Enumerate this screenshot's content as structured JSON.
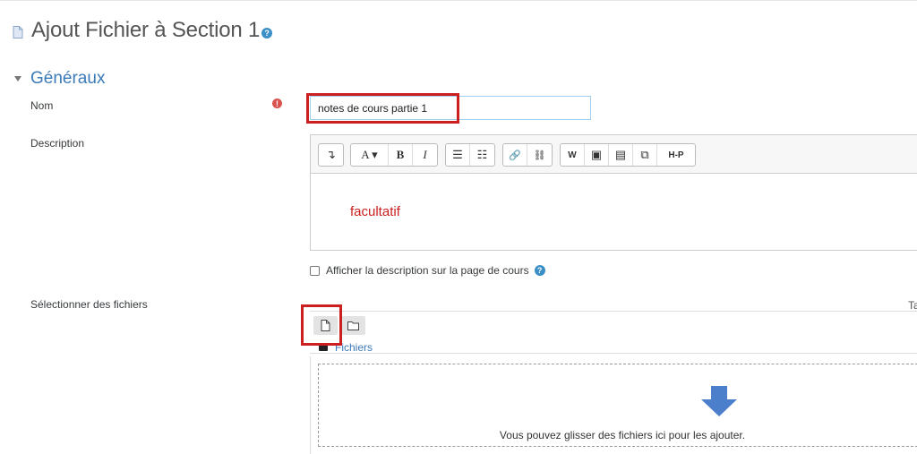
{
  "page": {
    "title": "Ajout Fichier à Section 1",
    "help_glyph": "?"
  },
  "section": {
    "title": "Généraux"
  },
  "form": {
    "name_label": "Nom",
    "required_glyph": "!",
    "name_value": "notes de cours partie 1",
    "description_label": "Description",
    "description_text": "facultatif",
    "show_description_label": "Afficher la description sur la page de cours",
    "files_label": "Sélectionner des fichiers",
    "truncated_right_text": "Ta"
  },
  "toolbar": {
    "groups": [
      {
        "buttons": [
          {
            "label": "↴",
            "icon": "show-more-icon"
          }
        ]
      },
      {
        "buttons": [
          {
            "label": "A ▾",
            "icon": "paragraph-style-icon"
          },
          {
            "label": "B",
            "icon": "bold-icon"
          },
          {
            "label": "I",
            "icon": "italic-icon"
          }
        ]
      },
      {
        "buttons": [
          {
            "label": "☰",
            "icon": "unordered-list-icon"
          },
          {
            "label": "☷",
            "icon": "ordered-list-icon"
          }
        ]
      },
      {
        "buttons": [
          {
            "label": "🔗",
            "icon": "link-icon"
          },
          {
            "label": "⛓",
            "icon": "unlink-icon"
          }
        ]
      },
      {
        "buttons": [
          {
            "label": "W",
            "icon": "word-import-icon"
          },
          {
            "label": "▣",
            "icon": "image-icon"
          },
          {
            "label": "▤",
            "icon": "media-icon"
          },
          {
            "label": "⧉",
            "icon": "manage-files-icon"
          },
          {
            "label": "H-P",
            "icon": "h5p-icon"
          }
        ]
      }
    ]
  },
  "filepicker": {
    "breadcrumb": "Fichiers",
    "drop_text": "Vous pouvez glisser des fichiers ici pour les ajouter."
  },
  "colors": {
    "accent": "#3b7ab8",
    "annotation_red": "#cc1f1f",
    "drop_arrow": "#4b7fcb"
  }
}
